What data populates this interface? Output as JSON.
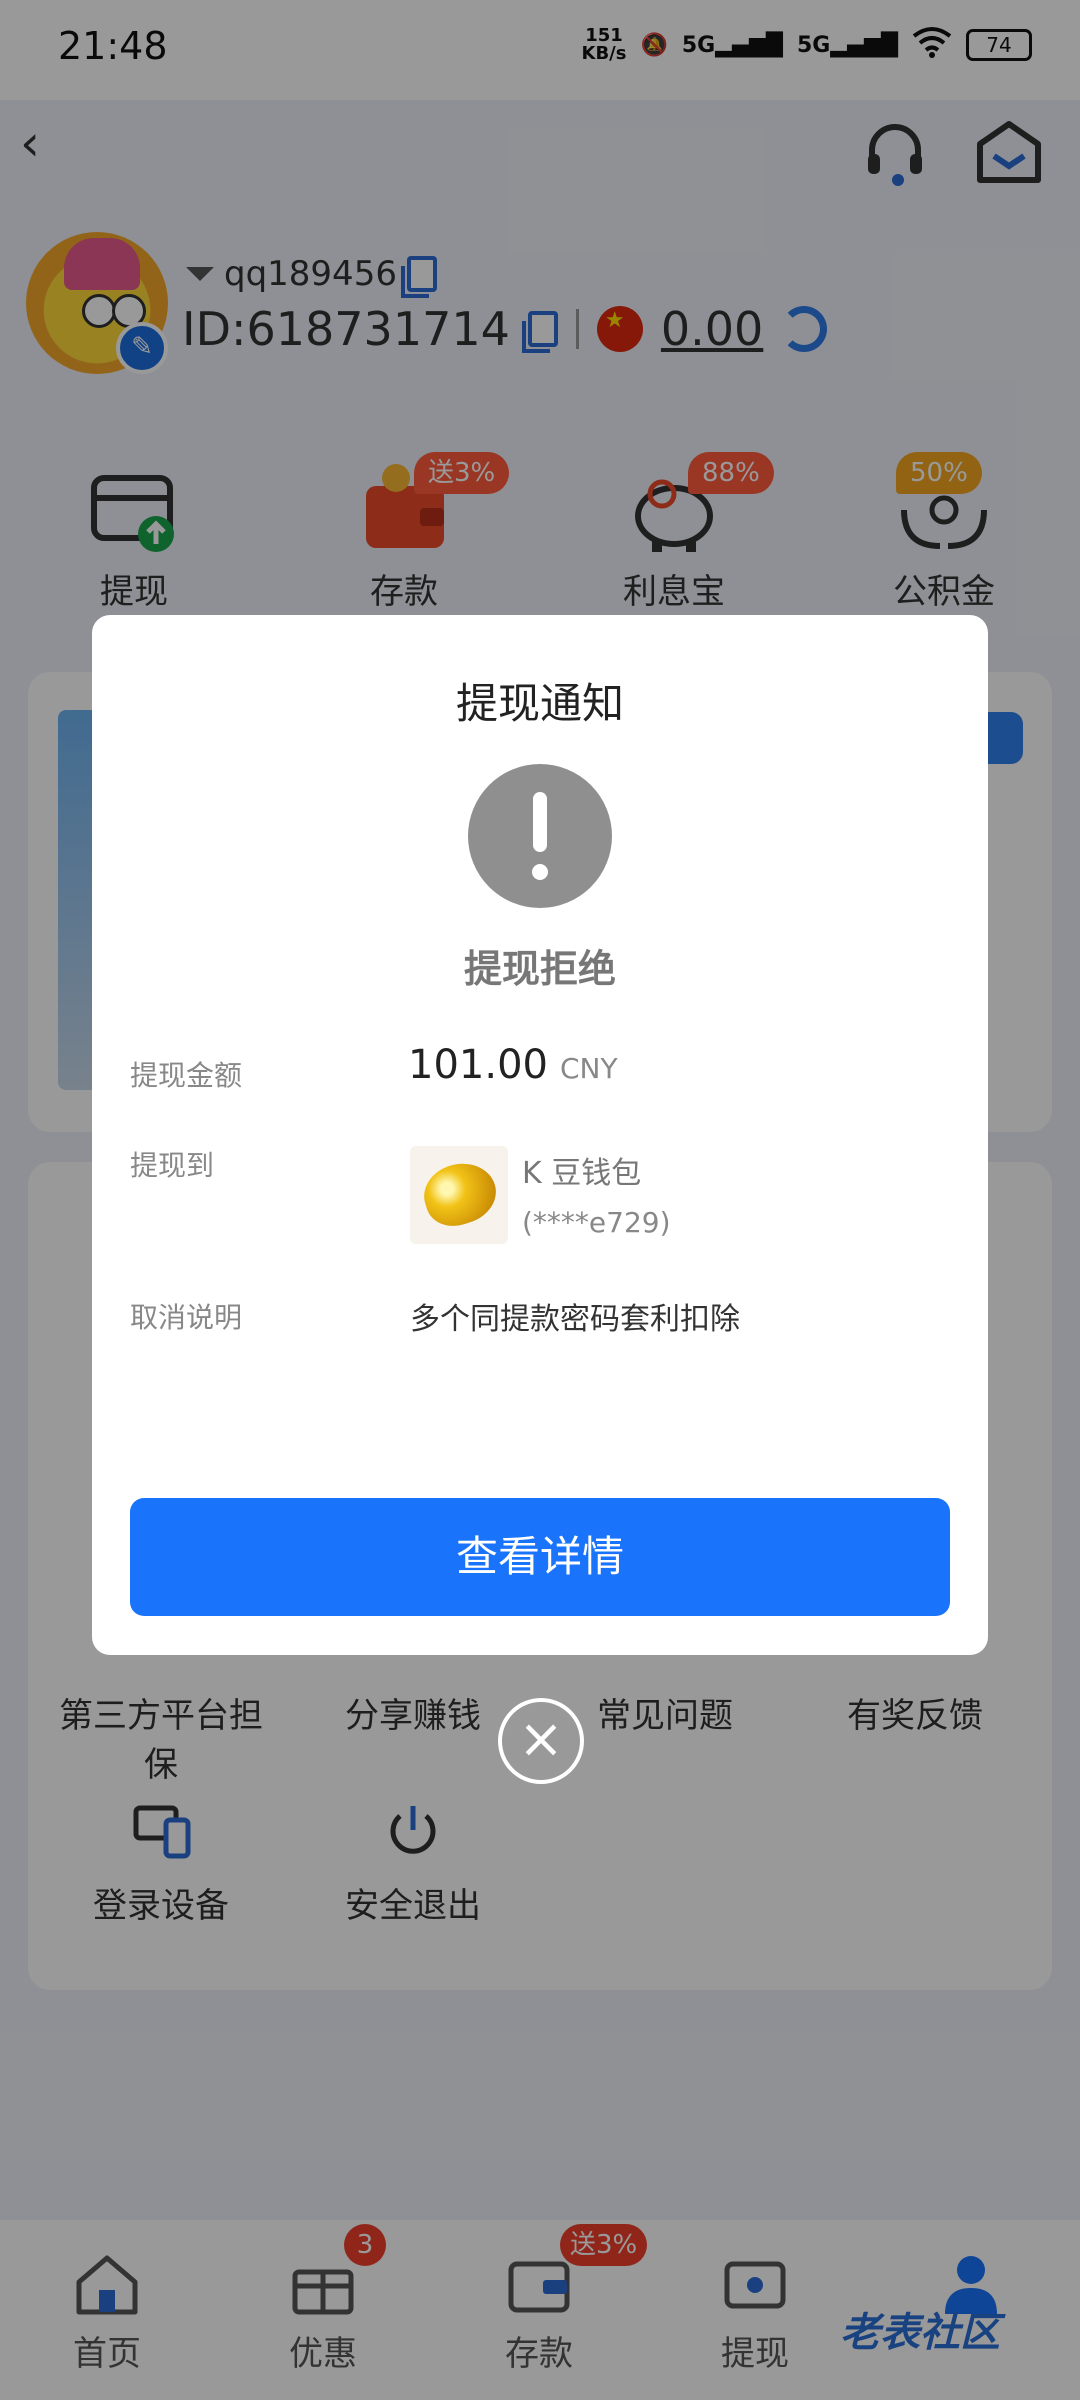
{
  "status_bar": {
    "time": "21:48",
    "net_speed": "151\nKB/s",
    "sig1": "5G",
    "sig2": "5G",
    "battery": "74"
  },
  "profile": {
    "username": "qq189456",
    "id_text": "ID:618731714",
    "balance": "0.00"
  },
  "quick_actions": [
    {
      "label": "提现",
      "icon": "withdraw-card-icon"
    },
    {
      "label": "存款",
      "icon": "wallet-icon",
      "badge": "送3%"
    },
    {
      "label": "利息宝",
      "icon": "piggy-bank-icon",
      "badge": "88%"
    },
    {
      "label": "公积金",
      "icon": "hands-coins-icon",
      "badge": "50%"
    }
  ],
  "grid_items": [
    {
      "label": "第三方平台担保"
    },
    {
      "label": "分享赚钱"
    },
    {
      "label": "常见问题"
    },
    {
      "label": "有奖反馈"
    },
    {
      "label": "登录设备"
    },
    {
      "label": "安全退出"
    }
  ],
  "tabs": [
    {
      "label": "首页",
      "icon": "home-icon"
    },
    {
      "label": "优惠",
      "icon": "gift-icon",
      "badge": "3"
    },
    {
      "label": "存款",
      "icon": "wallet-icon",
      "badge": "送3%"
    },
    {
      "label": "提现",
      "icon": "ticket-icon"
    },
    {
      "label": "",
      "icon": "user-icon"
    }
  ],
  "watermark": "老表社区",
  "dialog": {
    "title": "提现通知",
    "status": "提现拒绝",
    "amount_label": "提现金额",
    "amount": "101.00",
    "currency": "CNY",
    "to_label": "提现到",
    "wallet_name": "K 豆钱包",
    "wallet_account": "(****e729)",
    "cancel_label": "取消说明",
    "cancel_reason": "多个同提款密码套利扣除",
    "detail_button": "查看详情"
  },
  "colors": {
    "primary": "#1a73fb",
    "badge": "#ff5a3d",
    "status_gray": "#8f8f8f"
  }
}
